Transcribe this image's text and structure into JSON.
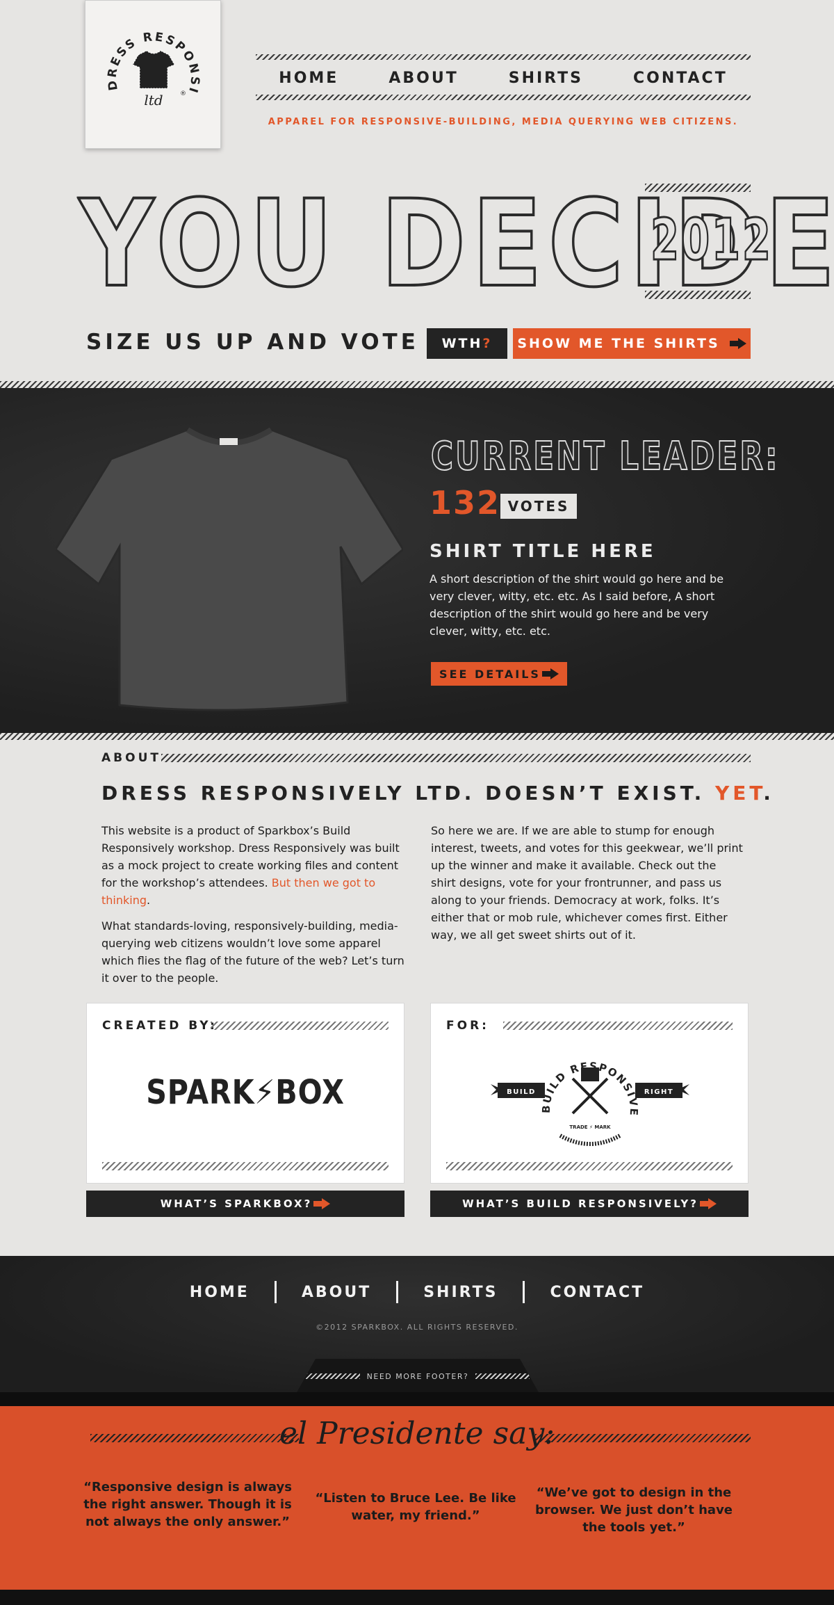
{
  "header": {
    "logo": {
      "arc_text": "DRESS RESPONSIVELY",
      "sub_text": "ltd",
      "registered": "®"
    },
    "nav": [
      "HOME",
      "ABOUT",
      "SHIRTS",
      "CONTACT"
    ],
    "tagline": "APPAREL FOR RESPONSIVE-BUILDING, MEDIA QUERYING WEB CITIZENS."
  },
  "hero": {
    "title": "YOU DECIDE",
    "year": "2012",
    "size_vote": "SIZE US UP AND VOTE",
    "wth_button": {
      "label": "WTH",
      "suffix": "?"
    },
    "show_button": "SHOW ME THE SHIRTS"
  },
  "leader": {
    "heading": "CURRENT LEADER:",
    "votes": "132",
    "votes_label": "VOTES",
    "shirt_title": "SHIRT TITLE HERE",
    "shirt_desc": "A short description of the shirt would go here and be very clever, witty, etc. etc. As I said before, A short description of the shirt would go here and be very clever, witty, etc. etc.",
    "details_button": "SEE DETAILS"
  },
  "about": {
    "label": "ABOUT",
    "headline_main": "DRESS RESPONSIVELY LTD. DOESN’T EXIST. ",
    "headline_accent": "YET",
    "headline_end": ".",
    "left_p1": "This website is a product of Sparkbox’s Build Responsively workshop. Dress Responsively was built as a mock project to create working files and content for the workshop’s attendees. ",
    "left_p1_link": "But then we got to thinking",
    "left_p1_end": ".",
    "left_p2": "What standards-loving, responsively-building, media-querying web citizens wouldn’t love some apparel which flies the flag of the future of the web? Let’s turn it over to the people.",
    "right_p1": "So here we are. If we are able to stump for enough interest, tweets, and votes for this geekwear, we’ll print up the winner and make it available. Check out the shirt designs, vote for your frontrunner, and pass us along to your friends. Democracy at work, folks. It’s either that or mob rule, whichever comes first. Either way, we all get sweet shirts out of it."
  },
  "cards": {
    "created_label": "CREATED BY:",
    "sparkbox_logo": "SPARK⚡BOX",
    "for_label": "FOR:",
    "build_logo": {
      "arc_text": "BUILD RESPONSIVELY",
      "left_ribbon": "BUILD",
      "right_ribbon": "RIGHT",
      "trademark": "TRADE ⚡ MARK"
    },
    "sparkbox_button": "WHAT’S SPARKBOX?",
    "build_button": "WHAT’S BUILD RESPONSIVELY?"
  },
  "footer": {
    "nav": [
      "HOME",
      "ABOUT",
      "SHIRTS",
      "CONTACT"
    ],
    "copyright": "©2012 SPARKBOX. ALL RIGHTS RESERVED.",
    "more_footer": "NEED MORE FOOTER?"
  },
  "quotes": {
    "heading": "el Presidente say:",
    "items": [
      "“Responsive design is always the right answer. Though it is not always the only answer.”",
      "“Listen to Bruce Lee. Be like water, my friend.”",
      "“We’ve got to design in the browser. We just don’t have the tools yet.”"
    ]
  },
  "colors": {
    "accent": "#e2572a",
    "dark": "#232323",
    "paper": "#e6e5e3",
    "quote_bg": "#d9502a"
  },
  "icons": [
    "shirt-icon",
    "arrow-right-icon",
    "lightning-icon"
  ]
}
